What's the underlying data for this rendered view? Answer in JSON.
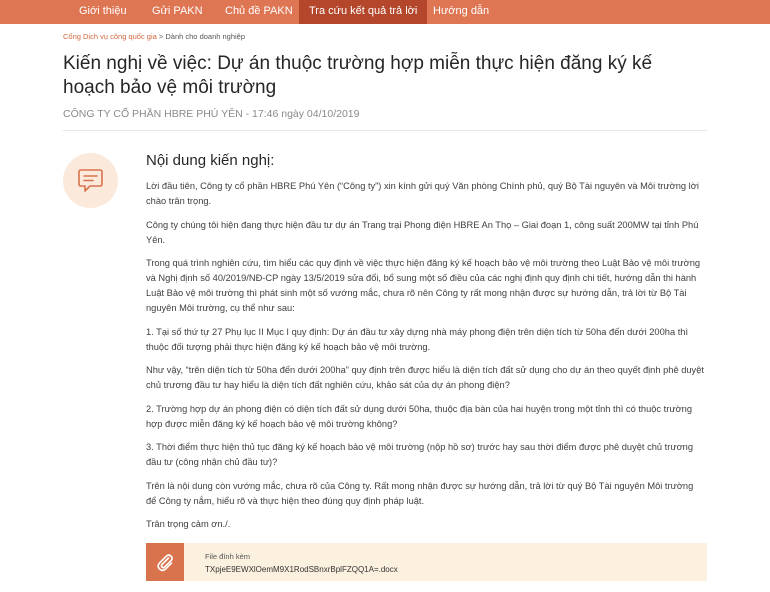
{
  "nav": {
    "items": [
      {
        "label": "Giới thiệu"
      },
      {
        "label": "Gửi PAKN"
      },
      {
        "label": "Chủ đề PAKN"
      },
      {
        "label": "Tra cứu kết quả trả lời"
      },
      {
        "label": "Hướng dẫn"
      }
    ],
    "active_index": 3
  },
  "breadcrumb": {
    "link": "Cổng Dịch vụ công quốc gia",
    "separator": " > ",
    "current": "Dành cho doanh nghiệp"
  },
  "title": "Kiến nghị về việc: Dự án thuộc trường hợp miễn thực hiện đăng ký kế hoạch bảo vệ môi trường",
  "meta": "CÔNG TY CỔ PHẦN HBRE PHÚ YÊN - 17:46 ngày 04/10/2019",
  "content": {
    "icon": "speech-bubble-icon",
    "heading": "Nội dung kiến nghị:",
    "paragraphs": [
      "Lời đầu tiên, Công ty cổ phần HBRE Phú Yên (“Công ty”) xin kính gửi quý Văn phòng Chính phủ, quý Bộ Tài nguyên và Môi trường lời chào trân trọng.",
      "Công ty chúng tôi hiện đang thực hiện đầu tư dự án Trang trại Phong điện HBRE An Thọ – Giai đoạn 1, công suất 200MW tại tỉnh Phú Yên.",
      "Trong quá trình nghiên cứu, tìm hiểu các quy định về việc thực hiện đăng ký kế hoạch bảo vệ môi trường theo Luật Bảo vệ môi trường và Nghị định số 40/2019/NĐ-CP ngày 13/5/2019 sửa đổi, bổ sung một số điều của các nghị định quy định chi tiết, hướng dẫn thi hành Luật Bảo vệ môi trường thì phát sinh một số vướng mắc, chưa rõ nên Công ty rất mong nhận được sự hướng dẫn, trả lời từ Bộ Tài nguyên Môi trường, cụ thể như sau:",
      "1. Tại số thứ tự 27 Phụ lục II Mục I quy định: Dự án đầu tư xây dựng nhà máy phong điện trên diện tích từ 50ha đến dưới 200ha thì thuộc đối tượng phải thực hiện đăng ký kế hoạch bảo vệ môi trường.",
      "Như vậy, “trên diện tích từ 50ha đến dưới 200ha” quy định trên được hiểu là diện tích đất sử dụng cho dự án theo quyết định phê duyệt chủ trương đầu tư hay hiểu là diện tích đất nghiên cứu, khảo sát của dự án phong điện?",
      "2. Trường hợp dự án phong điện có diện tích đất sử dụng dưới 50ha, thuộc địa bàn của hai huyện trong một tỉnh thì có thuộc trường hợp được miễn đăng ký kế hoạch bảo vệ môi trường không?",
      "3. Thời điểm thực hiện thủ tục đăng ký kế hoạch bảo vệ môi trường (nộp hồ sơ) trước hay sau thời điểm được phê duyệt chủ trương đầu tư (công nhận chủ đầu tư)?",
      "Trên là nội dung còn vướng mắc, chưa rõ của Công ty. Rất mong nhận được sự hướng dẫn, trả lời từ quý Bộ Tài nguyên Môi trường để Công ty nắm, hiểu rõ và thực hiện theo đúng quy định pháp luật.",
      "Trân trọng cảm ơn./."
    ]
  },
  "attachment": {
    "icon": "paperclip-icon",
    "label": "File đính kèm",
    "filename": "TXpjeE9EWXlOemM9X1RodSBnxrBplFZQQ1A=.docx"
  },
  "colors": {
    "nav_bg": "#de7654",
    "nav_active": "#b3462b",
    "accent": "#d9734e",
    "avatar_bg": "#fbe9dc",
    "attachment_bg": "#fcf0df"
  }
}
